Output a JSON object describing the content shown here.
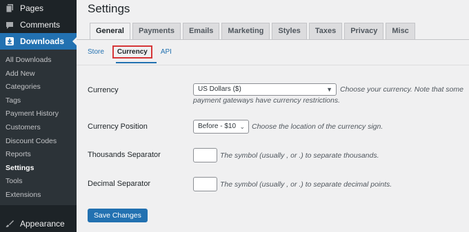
{
  "sidebar": {
    "top_items": [
      {
        "label": "Pages",
        "icon": "pages-icon"
      },
      {
        "label": "Comments",
        "icon": "comments-icon"
      },
      {
        "label": "Downloads",
        "icon": "downloads-icon"
      }
    ],
    "submenu": [
      "All Downloads",
      "Add New",
      "Categories",
      "Tags",
      "Payment History",
      "Customers",
      "Discount Codes",
      "Reports",
      "Settings",
      "Tools",
      "Extensions"
    ],
    "appearance_label": "Appearance"
  },
  "page_title": "Settings",
  "tabs": [
    "General",
    "Payments",
    "Emails",
    "Marketing",
    "Styles",
    "Taxes",
    "Privacy",
    "Misc"
  ],
  "subtabs": [
    "Store",
    "Currency",
    "API"
  ],
  "fields": {
    "currency": {
      "label": "Currency",
      "value": "US Dollars ($)",
      "desc_line1": "Choose your currency. Note that some",
      "desc_line2": "payment gateways have currency restrictions."
    },
    "position": {
      "label": "Currency Position",
      "value": "Before - $10",
      "desc": "Choose the location of the currency sign."
    },
    "thousands": {
      "label": "Thousands Separator",
      "value": "",
      "desc": "The symbol (usually , or .) to separate thousands."
    },
    "decimal": {
      "label": "Decimal Separator",
      "value": "",
      "desc": "The symbol (usually , or .) to separate decimal points."
    }
  },
  "save_label": "Save Changes",
  "colors": {
    "accent": "#2271b1",
    "sidebar": "#1d2327",
    "highlight_border": "#d63638"
  }
}
